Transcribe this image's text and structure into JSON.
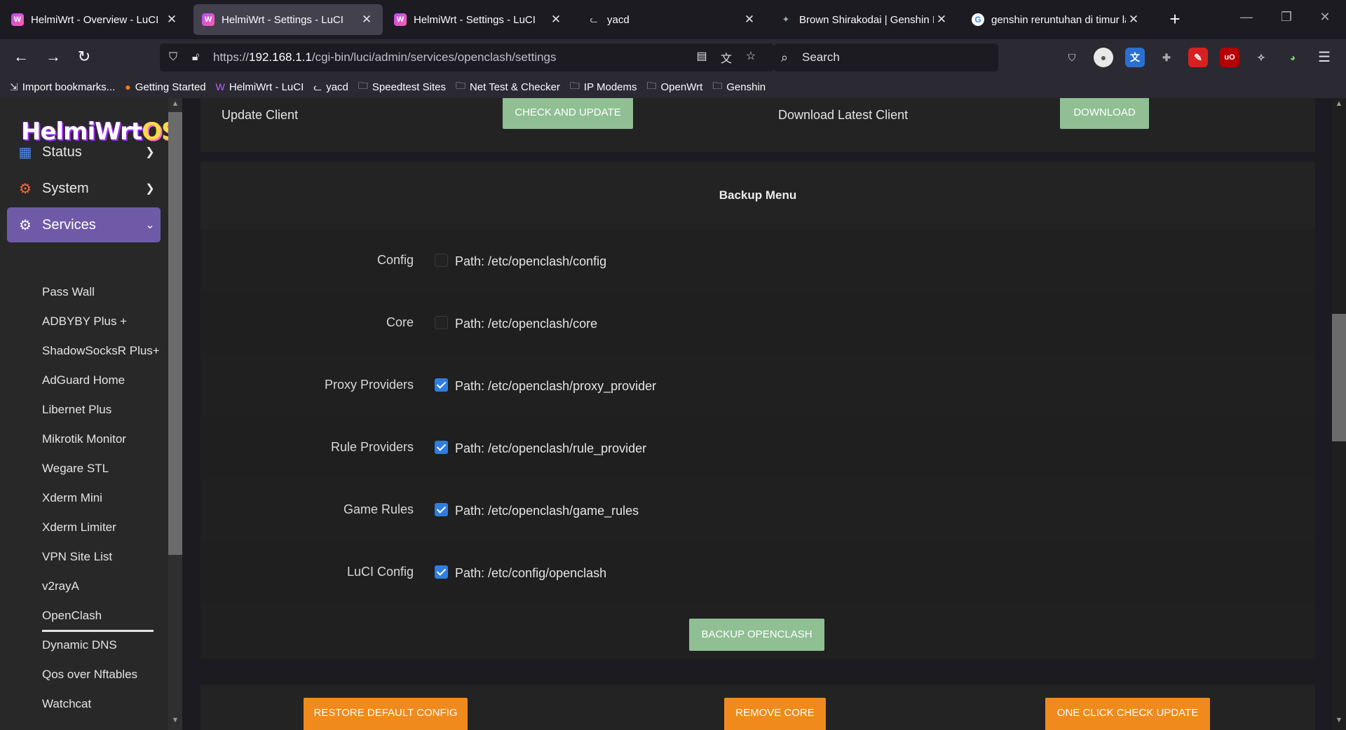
{
  "browser": {
    "tabs": [
      {
        "title": "HelmiWrt - Overview - LuCI",
        "icon": "helmiwrt-favicon",
        "active": false
      },
      {
        "title": "HelmiWrt - Settings - LuCI",
        "icon": "helmiwrt-favicon",
        "active": true
      },
      {
        "title": "HelmiWrt - Settings - LuCI",
        "icon": "helmiwrt-favicon",
        "active": false
      },
      {
        "title": "yacd",
        "icon": "cat-favicon",
        "active": false
      },
      {
        "title": "Brown Shirakodai | Genshin Im",
        "icon": "genshin-favicon",
        "active": false
      },
      {
        "title": "genshin reruntuhan di timur la",
        "icon": "google-favicon",
        "active": false
      }
    ],
    "close_glyph": "✕",
    "new_tab_glyph": "+",
    "url_prefix": "https://",
    "url_host": "192.168.1.1",
    "url_path": "/cgi-bin/luci/admin/services/openclash/settings",
    "search_placeholder": "Search",
    "bookmarks": [
      {
        "label": "Import bookmarks...",
        "icon": "import-icon"
      },
      {
        "label": "Getting Started",
        "icon": "firefox-icon"
      },
      {
        "label": "HelmiWrt - LuCI",
        "icon": "helmiwrt-favicon"
      },
      {
        "label": "yacd",
        "icon": "cat-favicon"
      },
      {
        "label": "Speedtest Sites",
        "icon": "folder-icon"
      },
      {
        "label": "Net Test & Checker",
        "icon": "folder-icon"
      },
      {
        "label": "IP Modems",
        "icon": "folder-icon"
      },
      {
        "label": "OpenWrt",
        "icon": "folder-icon"
      },
      {
        "label": "Genshin",
        "icon": "folder-icon"
      }
    ]
  },
  "sidebar": {
    "logo_part1": "HelmiWrt",
    "logo_part2": "OS",
    "menu": [
      {
        "label": "Status",
        "icon": "dashboard-icon"
      },
      {
        "label": "System",
        "icon": "gear-icon"
      },
      {
        "label": "Services",
        "icon": "services-icon"
      }
    ],
    "submenu": [
      "Pass Wall",
      "ADBYBY Plus +",
      "ShadowSocksR Plus+",
      "AdGuard Home",
      "Libernet Plus",
      "Mikrotik Monitor",
      "Wegare STL",
      "Xderm Mini",
      "Xderm Limiter",
      "VPN Site List",
      "v2rayA",
      "OpenClash",
      "Dynamic DNS",
      "Qos over Nftables",
      "Watchcat"
    ],
    "active_submenu": "OpenClash"
  },
  "update": {
    "client_label": "Update Client",
    "check_button": "CHECK AND UPDATE",
    "download_label": "Download Latest Client",
    "download_button": "DOWNLOAD"
  },
  "backup": {
    "title": "Backup Menu",
    "items": [
      {
        "label": "Config",
        "path": "Path: /etc/openclash/config",
        "checked": false
      },
      {
        "label": "Core",
        "path": "Path: /etc/openclash/core",
        "checked": false
      },
      {
        "label": "Proxy Providers",
        "path": "Path: /etc/openclash/proxy_provider",
        "checked": true
      },
      {
        "label": "Rule Providers",
        "path": "Path: /etc/openclash/rule_provider",
        "checked": true
      },
      {
        "label": "Game Rules",
        "path": "Path: /etc/openclash/game_rules",
        "checked": true
      },
      {
        "label": "LuCI Config",
        "path": "Path: /etc/config/openclash",
        "checked": true
      }
    ],
    "backup_button": "BACKUP OPENCLASH"
  },
  "bottom_buttons": {
    "restore": "RESTORE DEFAULT CONFIG",
    "remove": "REMOVE CORE",
    "one_click": "ONE CLICK CHECK UPDATE"
  },
  "colors": {
    "accent_purple": "#6f5aa8",
    "green_button": "#8fbf93",
    "orange_button": "#f08a1c",
    "checkbox_blue": "#2f7de1"
  }
}
